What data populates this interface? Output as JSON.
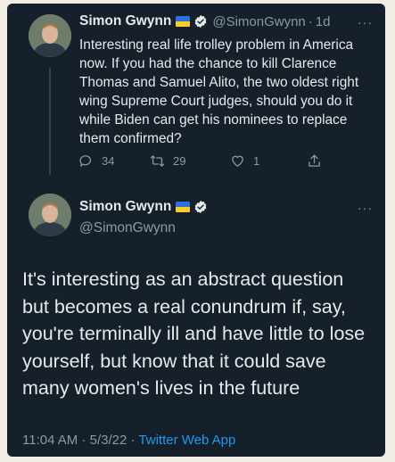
{
  "tweet_reply_to": {
    "author_name": "Simon Gwynn",
    "author_handle": "@SimonGwynn",
    "separator": "·",
    "age": "1d",
    "more": "···",
    "text": "Interesting real life trolley problem in America now. If you had the chance to kill Clarence Thomas and Samuel Alito, the two oldest right wing Supreme Court judges, should you do it while Biden can get his nominees to replace them confirmed?",
    "reply_count": "34",
    "retweet_count": "29",
    "like_count": "1"
  },
  "tweet_main": {
    "author_name": "Simon Gwynn",
    "author_handle": "@SimonGwynn",
    "more": "···",
    "text": "It's interesting as an abstract question but becomes a real conundrum if, say, you're terminally ill and have little to lose yourself, but know that it could save many women's lives in the future",
    "time": "11:04 AM",
    "date": "5/3/22",
    "separator": "·",
    "source": "Twitter Web App"
  },
  "colors": {
    "background": "#15202b",
    "text": "#e7e9ea",
    "secondary": "#8b98a5",
    "accent": "#1d9bf0"
  }
}
